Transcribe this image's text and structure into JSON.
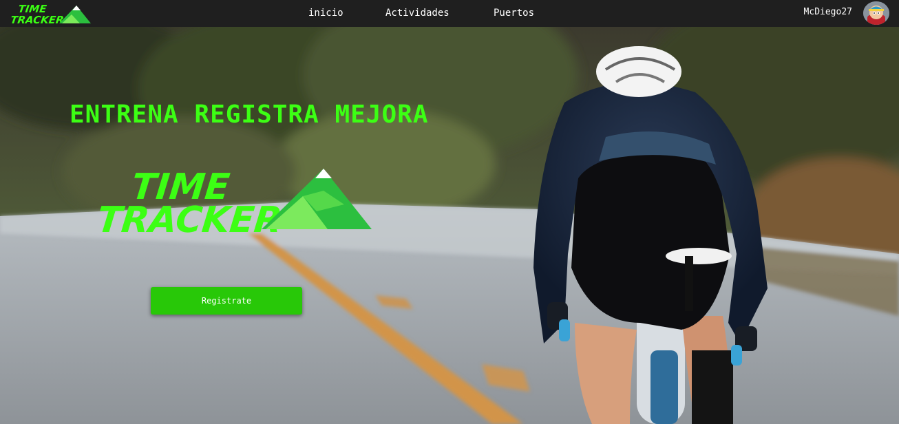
{
  "brand": {
    "logo_text_line1": "TIME",
    "logo_text_line2": "TRACKER",
    "accent": "#3cff14"
  },
  "nav": {
    "items": [
      {
        "label": "inicio"
      },
      {
        "label": "Actividades"
      },
      {
        "label": "Puertos"
      }
    ]
  },
  "user": {
    "name": "McDiego27"
  },
  "hero": {
    "tagline": "ENTRENA REGISTRA MEJORA",
    "logo_text_line1": "TIME",
    "logo_text_line2": "TRACKER",
    "cta_label": "Registrate",
    "cta_color": "#28c808"
  }
}
